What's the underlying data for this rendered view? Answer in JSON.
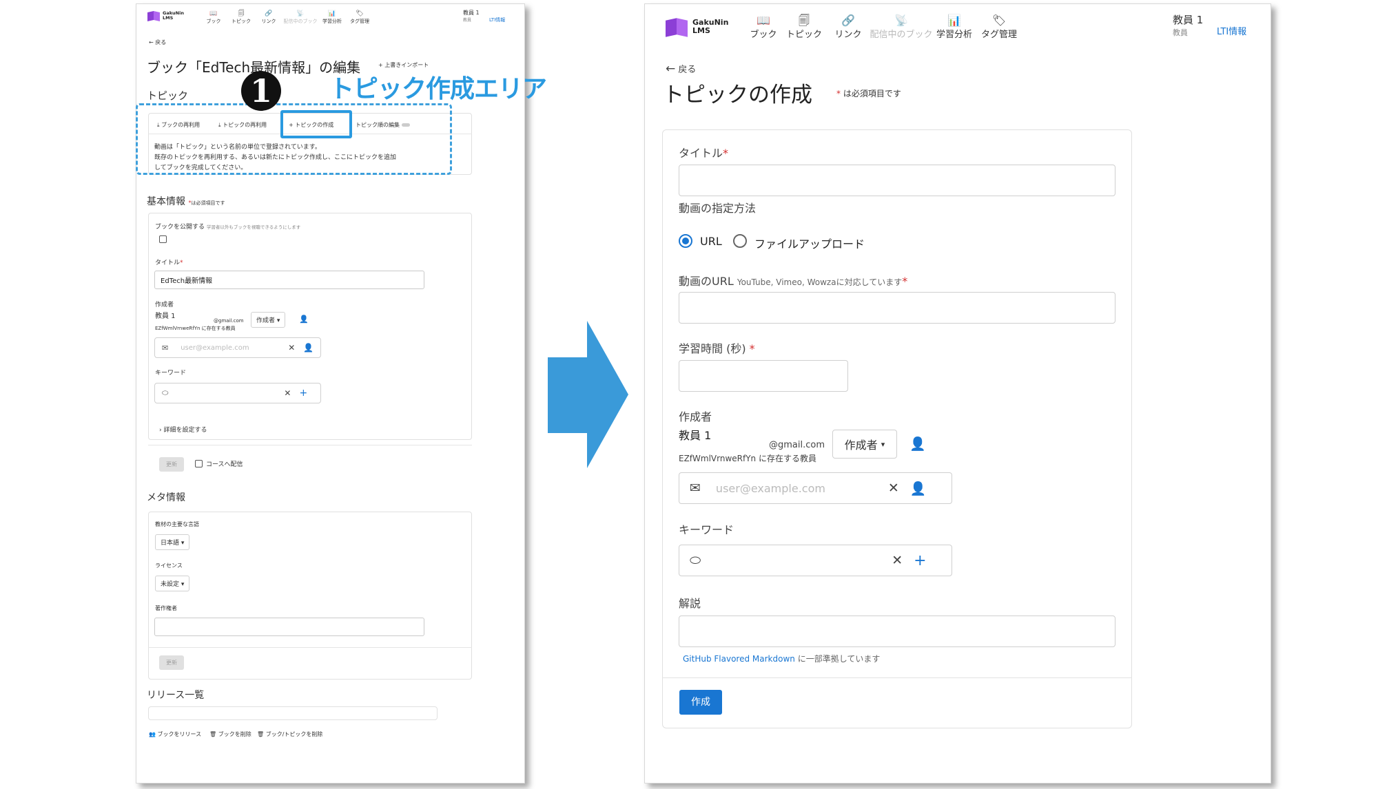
{
  "app": {
    "logo_top": "GakuNin",
    "logo_bottom": "LMS"
  },
  "nav": [
    {
      "label": "ブック",
      "icon": "book-icon",
      "dim": false
    },
    {
      "label": "トピック",
      "icon": "topic-icon",
      "dim": false
    },
    {
      "label": "リンク",
      "icon": "link-icon",
      "dim": false
    },
    {
      "label": "配信中のブック",
      "icon": "broadcast-icon",
      "dim": true
    },
    {
      "label": "学習分析",
      "icon": "analytics-icon",
      "dim": false
    },
    {
      "label": "タグ管理",
      "icon": "tag-icon",
      "dim": false
    }
  ],
  "user": {
    "name": "教員 1",
    "role": "教員",
    "lti": "LTI情報"
  },
  "left": {
    "back": "戻る",
    "title": "ブック「EdTech最新情報」の編集",
    "import_link": "上書きインポート",
    "topic_heading": "トピック",
    "toolbar": {
      "reuse_book": "ブックの再利用",
      "reuse_topic": "トピックの再利用",
      "create_topic": "トピックの作成",
      "edit_order": "トピック順の編集"
    },
    "topic_desc": [
      "動画は「トピック」という名前の単位で登録されています。",
      "既存のトピックを再利用する、あるいは新たにトピック作成し、ここにトピックを追加",
      "してブックを完成してください。"
    ],
    "basic_heading": "基本情報",
    "required_note": "は必須項目です",
    "publish_label": "ブックを公開する",
    "publish_hint": "学習者以外もブックを視聴できるようにします",
    "title_label": "タイトル",
    "title_value": "EdTech最新情報",
    "author_label": "作成者",
    "author_name": "教員 1",
    "author_email": "@gmail.com",
    "author_org": "EZfWmlVrnweRfYn に存在する教員",
    "author_role": "作成者",
    "email_placeholder": "user@example.com",
    "keyword_label": "キーワード",
    "details_toggle": "詳細を設定する",
    "update_button": "更新",
    "course_deliver": "コースへ配信",
    "meta_heading": "メタ情報",
    "language_label": "教材の主要な言語",
    "language_value": "日本語",
    "license_label": "ライセンス",
    "license_value": "未設定",
    "copyright_label": "著作権者",
    "update_button2": "更新",
    "release_heading": "リリース一覧",
    "footer_links": [
      "ブックをリリース",
      "ブックを削除",
      "ブック/トピックを削除"
    ]
  },
  "annotation": {
    "number": "1",
    "label": "トピック作成エリア"
  },
  "right": {
    "back": "戻る",
    "title": "トピックの作成",
    "required_note": "は必須項目です",
    "title_label": "タイトル",
    "video_method_label": "動画の指定方法",
    "radio_url": "URL",
    "radio_upload": "ファイルアップロード",
    "url_label": "動画のURL",
    "url_hint": "YouTube, Vimeo, Wowzaに対応しています",
    "time_label": "学習時間 (秒)",
    "author_label": "作成者",
    "author_name": "教員 1",
    "author_email": "@gmail.com",
    "author_org": "EZfWmlVrnweRfYn に存在する教員",
    "author_role": "作成者",
    "email_placeholder": "user@example.com",
    "keyword_label": "キーワード",
    "desc_label": "解説",
    "markdown_link": "GitHub Flavored Markdown",
    "markdown_note": "に一部準拠しています",
    "create_button": "作成"
  },
  "colors": {
    "primary": "#1976d2",
    "annotation": "#2a9ae0",
    "arrow": "#3a9ad9",
    "required": "#d32f2f"
  }
}
